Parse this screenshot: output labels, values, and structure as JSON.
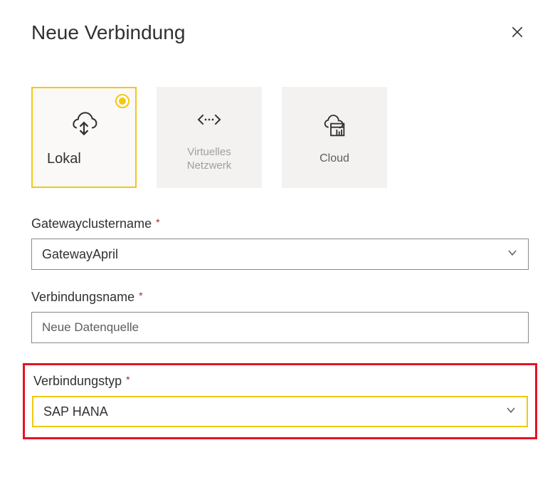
{
  "header": {
    "title": "Neue Verbindung"
  },
  "tiles": {
    "local": {
      "label": "Lokal"
    },
    "vnet": {
      "label": "Virtuelles Netzwerk"
    },
    "cloud": {
      "label": "Cloud"
    }
  },
  "form": {
    "gateway_cluster": {
      "label": "Gatewayclustername",
      "value": "GatewayApril"
    },
    "connection_name": {
      "label": "Verbindungsname",
      "placeholder": "Neue Datenquelle"
    },
    "connection_type": {
      "label": "Verbindungstyp",
      "value": "SAP HANA"
    }
  }
}
